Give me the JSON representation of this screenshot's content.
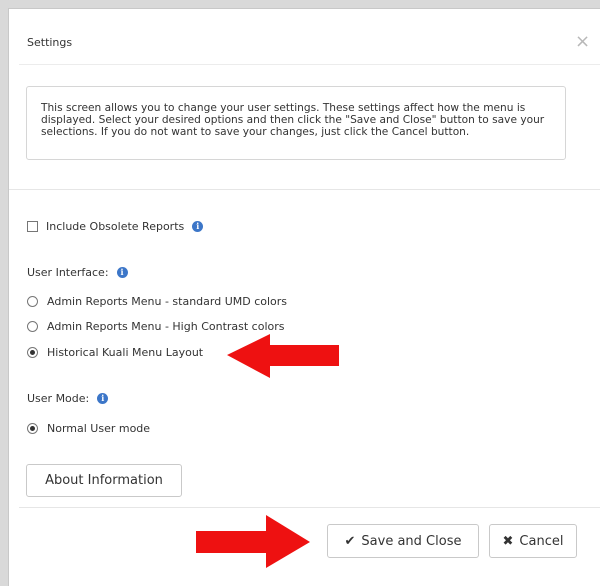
{
  "dialog": {
    "title": "Settings",
    "close_icon": "close-icon",
    "description": "This screen allows you to change your user settings. These settings affect how the menu is displayed. Select your desired options and then click the \"Save and Close\" button to save your selections. If you do not want to save your changes, just click the Cancel button."
  },
  "options": {
    "include_obsolete_label": "Include Obsolete Reports",
    "include_obsolete_checked": false,
    "user_interface_label": "User Interface:",
    "ui_choices": [
      {
        "label": "Admin Reports Menu - standard UMD colors",
        "selected": false
      },
      {
        "label": "Admin Reports Menu - High Contrast colors",
        "selected": false
      },
      {
        "label": "Historical Kuali Menu Layout",
        "selected": true
      }
    ],
    "user_mode_label": "User Mode:",
    "mode_choices": [
      {
        "label": "Normal User mode",
        "selected": true
      }
    ],
    "info_icon": "i"
  },
  "buttons": {
    "about": "About Information",
    "save": "Save and Close",
    "save_icon": "✔",
    "cancel": "Cancel",
    "cancel_icon": "✖"
  },
  "colors": {
    "arrow": "#ee1111",
    "info": "#3c76c8"
  }
}
